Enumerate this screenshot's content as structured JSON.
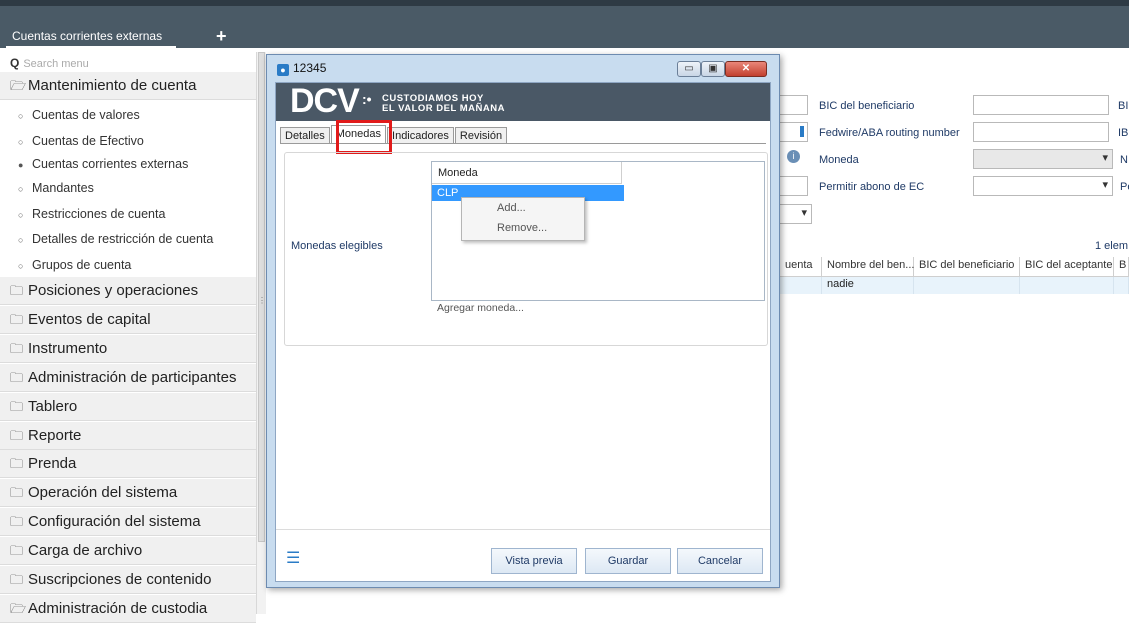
{
  "topbar": {
    "tab_label": "Cuentas corrientes externas",
    "plus": "+"
  },
  "sidebar": {
    "search_placeholder": "Search menu",
    "sections": [
      {
        "label": "Mantenimiento de cuenta",
        "icon": "folder-open-icon"
      },
      {
        "label": "Posiciones y operaciones",
        "icon": "folder-icon"
      },
      {
        "label": "Eventos de capital",
        "icon": "folder-icon"
      },
      {
        "label": "Instrumento",
        "icon": "folder-icon"
      },
      {
        "label": "Administración de participantes",
        "icon": "folder-icon"
      },
      {
        "label": "Tablero",
        "icon": "folder-icon"
      },
      {
        "label": "Reporte",
        "icon": "folder-icon"
      },
      {
        "label": "Prenda",
        "icon": "folder-icon"
      },
      {
        "label": "Operación del sistema",
        "icon": "folder-icon"
      },
      {
        "label": "Configuración del sistema",
        "icon": "folder-icon"
      },
      {
        "label": "Carga de archivo",
        "icon": "folder-icon"
      },
      {
        "label": "Suscripciones de contenido",
        "icon": "folder-icon"
      },
      {
        "label": "Administración de custodia",
        "icon": "folder-open-icon"
      }
    ],
    "subitems": [
      {
        "label": "Cuentas de valores",
        "selected": false
      },
      {
        "label": "Cuentas de Efectivo",
        "selected": false
      },
      {
        "label": "Cuentas corrientes externas",
        "selected": true
      },
      {
        "label": "Mandantes",
        "selected": false
      },
      {
        "label": "Restricciones de cuenta",
        "selected": false
      },
      {
        "label": "Detalles de restricción de cuenta",
        "selected": false
      },
      {
        "label": "Grupos de cuenta",
        "selected": false
      }
    ]
  },
  "background": {
    "labels": {
      "bic_beneficiario": "BIC del beneficiario",
      "fedwire": "Fedwire/ABA routing number",
      "moneda": "Moneda",
      "permitir": "Permitir abono de EC",
      "bi_cut": "BI",
      "iba_cut": "IB",
      "no_cut": "N",
      "pe_cut": "Pe",
      "count": "1 elem"
    },
    "grid_headers": [
      "uenta",
      "Nombre del ben...",
      "BIC del beneficiario",
      "BIC del aceptante",
      "B"
    ],
    "grid_row": [
      "",
      "nadie",
      "",
      "",
      ""
    ]
  },
  "dialog": {
    "title": "12345",
    "logo": "DCV",
    "slogan_1": "CUSTODIAMOS HOY",
    "slogan_2": "EL VALOR DEL MAÑANA",
    "tabs": [
      {
        "label": "Detalles",
        "active": false
      },
      {
        "label": "Monedas",
        "active": true
      },
      {
        "label": "Indicadores",
        "active": false
      },
      {
        "label": "Revisión",
        "active": false
      }
    ],
    "field_label": "Monedas elegibles",
    "list_header": "Moneda",
    "list_rows": [
      "CLP"
    ],
    "context_menu": [
      "Add...",
      "Remove..."
    ],
    "add_link": "Agregar moneda...",
    "buttons": {
      "preview": "Vista previa",
      "save": "Guardar",
      "cancel": "Cancelar"
    },
    "window_buttons": {
      "minimize": "▭",
      "maximize": "▣",
      "close": "✕"
    }
  },
  "colors": {
    "accent": "#2a7bc6",
    "highlight_box": "#e11a1a",
    "topbar": "#4a5a66",
    "selection": "#3399ff"
  }
}
